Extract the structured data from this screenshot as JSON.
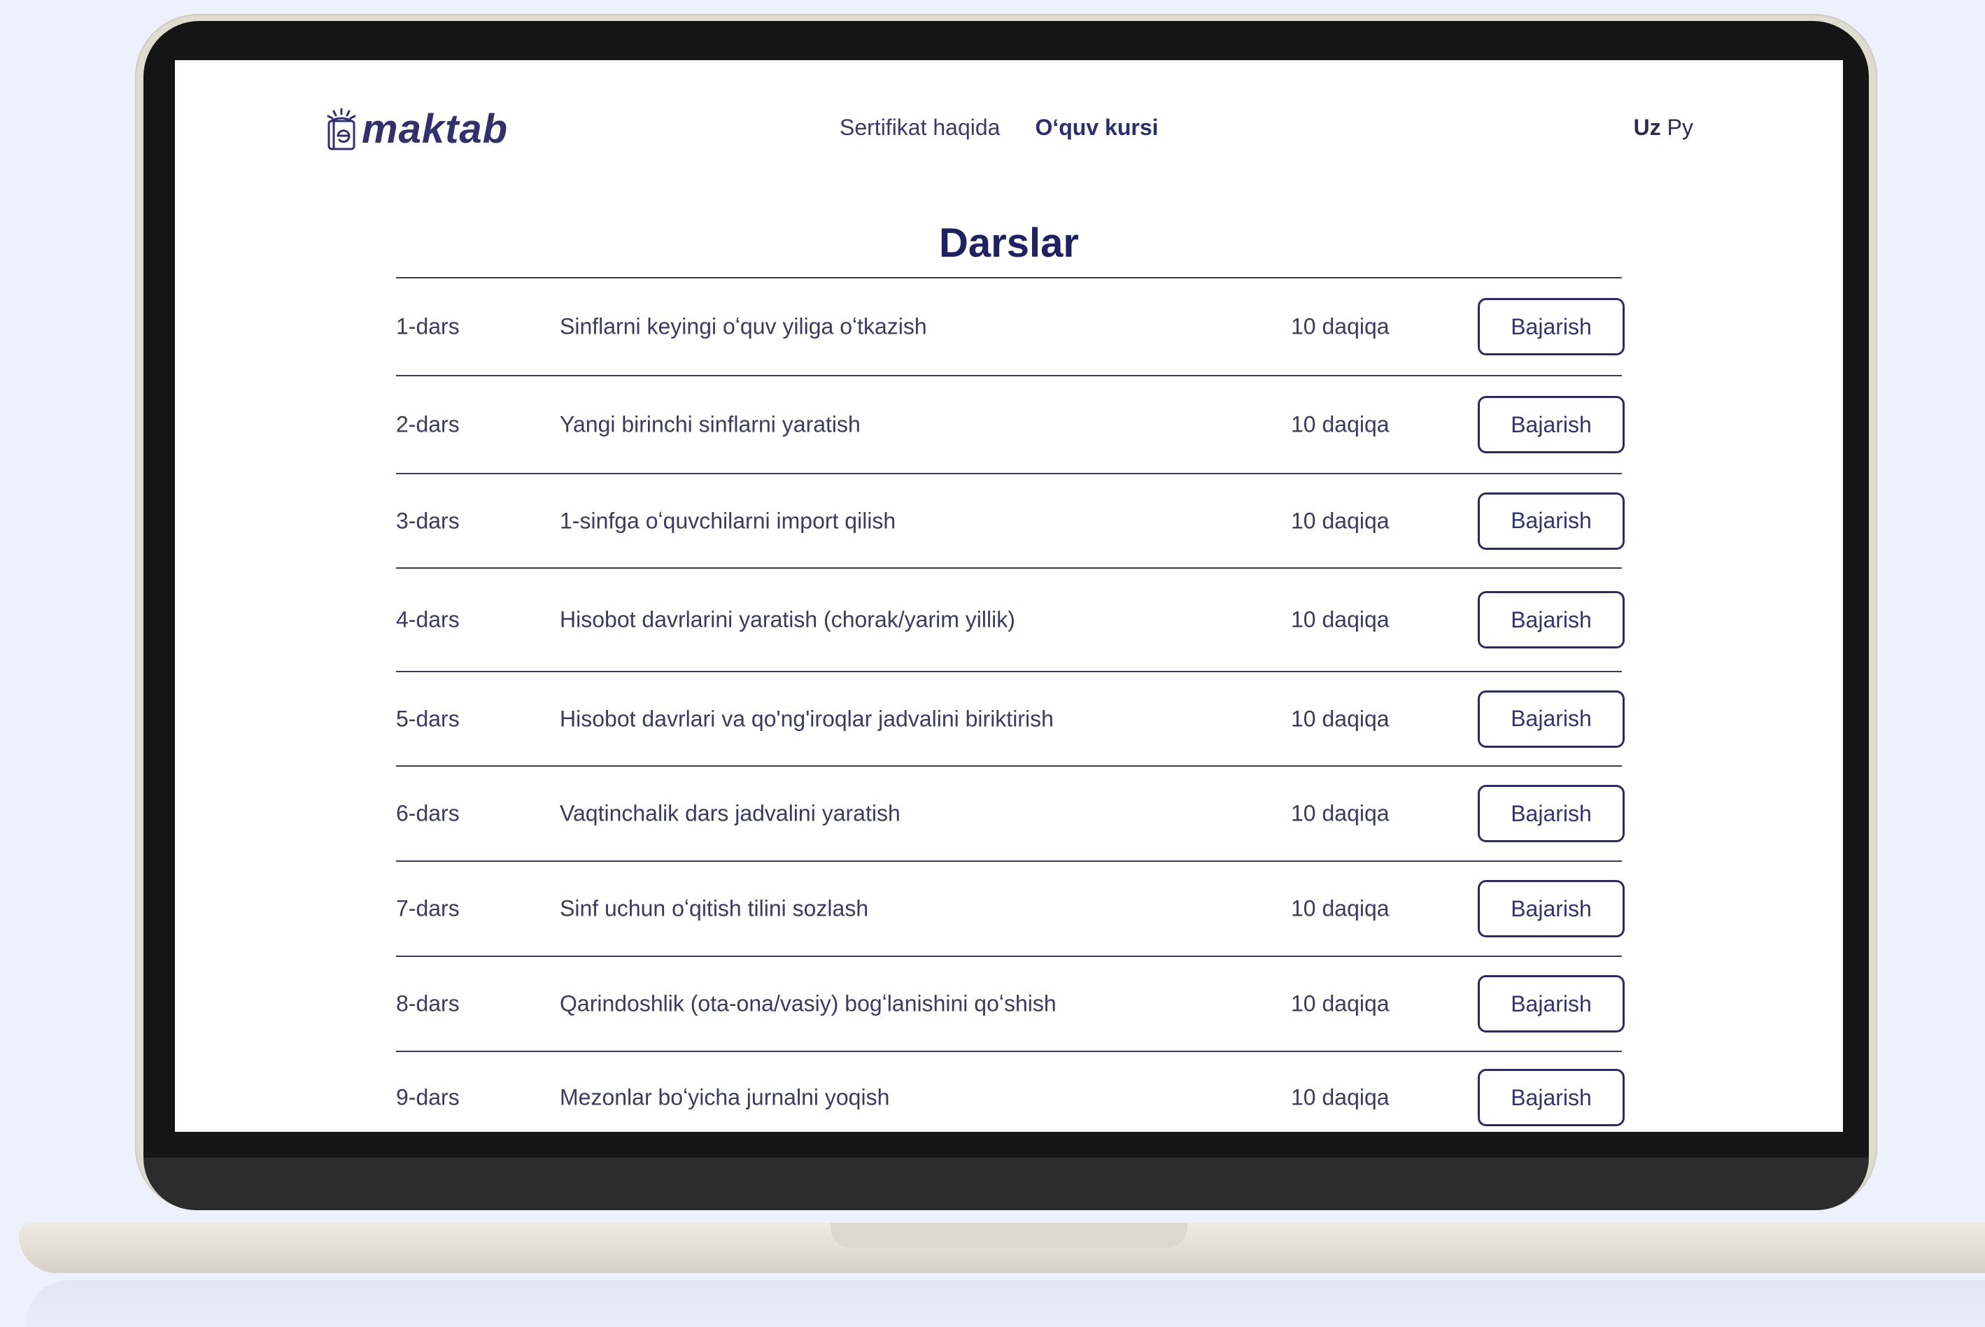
{
  "brand": {
    "name": "maktab",
    "icon": "e-book-sun-icon",
    "color": "#34306b"
  },
  "nav": {
    "items": [
      "Sertifikat haqida",
      "Oʻquv kursi"
    ],
    "active_index": 1
  },
  "lang": {
    "items": [
      "Uz",
      "Ру"
    ],
    "active_index": 0
  },
  "page": {
    "title": "Darslar"
  },
  "lessons": [
    {
      "num": "1-dars",
      "name": "Sinflarni keyingi oʻquv yiliga oʻtkazish",
      "duration": "10 daqiqa",
      "action": "Bajarish"
    },
    {
      "num": "2-dars",
      "name": "Yangi birinchi sinflarni yaratish",
      "duration": "10 daqiqa",
      "action": "Bajarish"
    },
    {
      "num": "3-dars",
      "name": "1-sinfga oʻquvchilarni import qilish",
      "duration": "10 daqiqa",
      "action": "Bajarish"
    },
    {
      "num": "4-dars",
      "name": "Hisobot davrlarini yaratish (chorak/yarim yillik)",
      "duration": "10 daqiqa",
      "action": "Bajarish"
    },
    {
      "num": "5-dars",
      "name": "Hisobot davrlari va qo'ng'iroqlar jadvalini biriktirish",
      "duration": "10 daqiqa",
      "action": "Bajarish"
    },
    {
      "num": "6-dars",
      "name": "Vaqtinchalik dars jadvalini yaratish",
      "duration": "10 daqiqa",
      "action": "Bajarish"
    },
    {
      "num": "7-dars",
      "name": "Sinf uchun oʻqitish tilini sozlash",
      "duration": "10 daqiqa",
      "action": "Bajarish"
    },
    {
      "num": "8-dars",
      "name": "Qarindoshlik (ota-ona/vasiy) bogʻlanishini qoʻshish",
      "duration": "10 daqiqa",
      "action": "Bajarish"
    },
    {
      "num": "9-dars",
      "name": "Mezonlar boʻyicha jurnalni yoqish",
      "duration": "10 daqiqa",
      "action": "Bajarish"
    }
  ]
}
